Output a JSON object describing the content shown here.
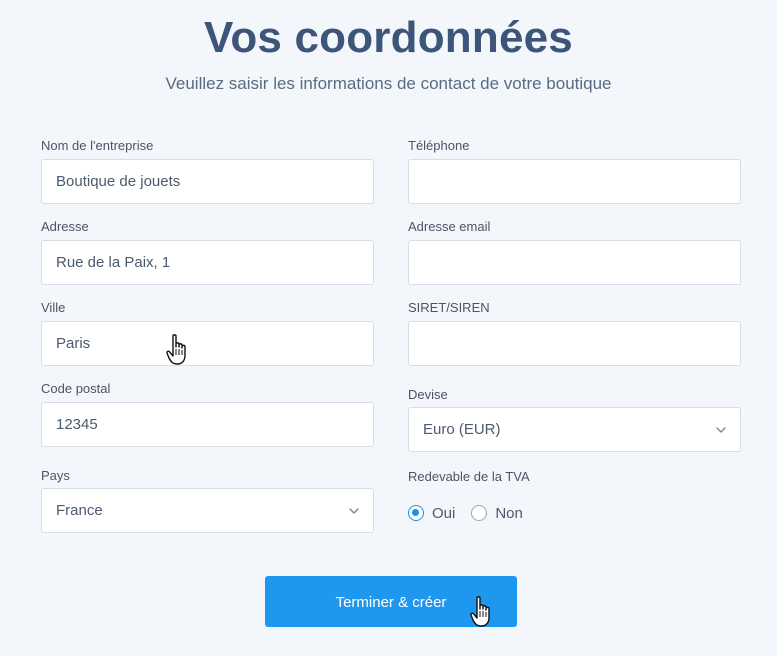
{
  "header": {
    "title": "Vos coordonnées",
    "subtitle": "Veuillez saisir les informations de contact de votre boutique"
  },
  "form": {
    "company": {
      "label": "Nom de l'entreprise",
      "value": "Boutique de jouets"
    },
    "address": {
      "label": "Adresse",
      "value": "Rue de la Paix, 1"
    },
    "city": {
      "label": "Ville",
      "value": "Paris"
    },
    "postal_code": {
      "label": "Code postal",
      "value": "12345"
    },
    "country": {
      "label": "Pays",
      "value": "France"
    },
    "phone": {
      "label": "Téléphone",
      "value": ""
    },
    "email": {
      "label": "Adresse email",
      "value": ""
    },
    "siret": {
      "label": "SIRET/SIREN",
      "value": ""
    },
    "currency": {
      "label": "Devise",
      "value": "Euro (EUR)"
    },
    "vat": {
      "label": "Redevable de la TVA",
      "options": [
        {
          "label": "Oui",
          "checked": true
        },
        {
          "label": "Non",
          "checked": false
        }
      ]
    },
    "submit_label": "Terminer & créer"
  },
  "colors": {
    "accent": "#1e98ef",
    "title": "#3d5578",
    "background": "#f3f7fb"
  },
  "icons": [
    "chevron-down-icon",
    "hand-pointer-cursor-icon"
  ]
}
